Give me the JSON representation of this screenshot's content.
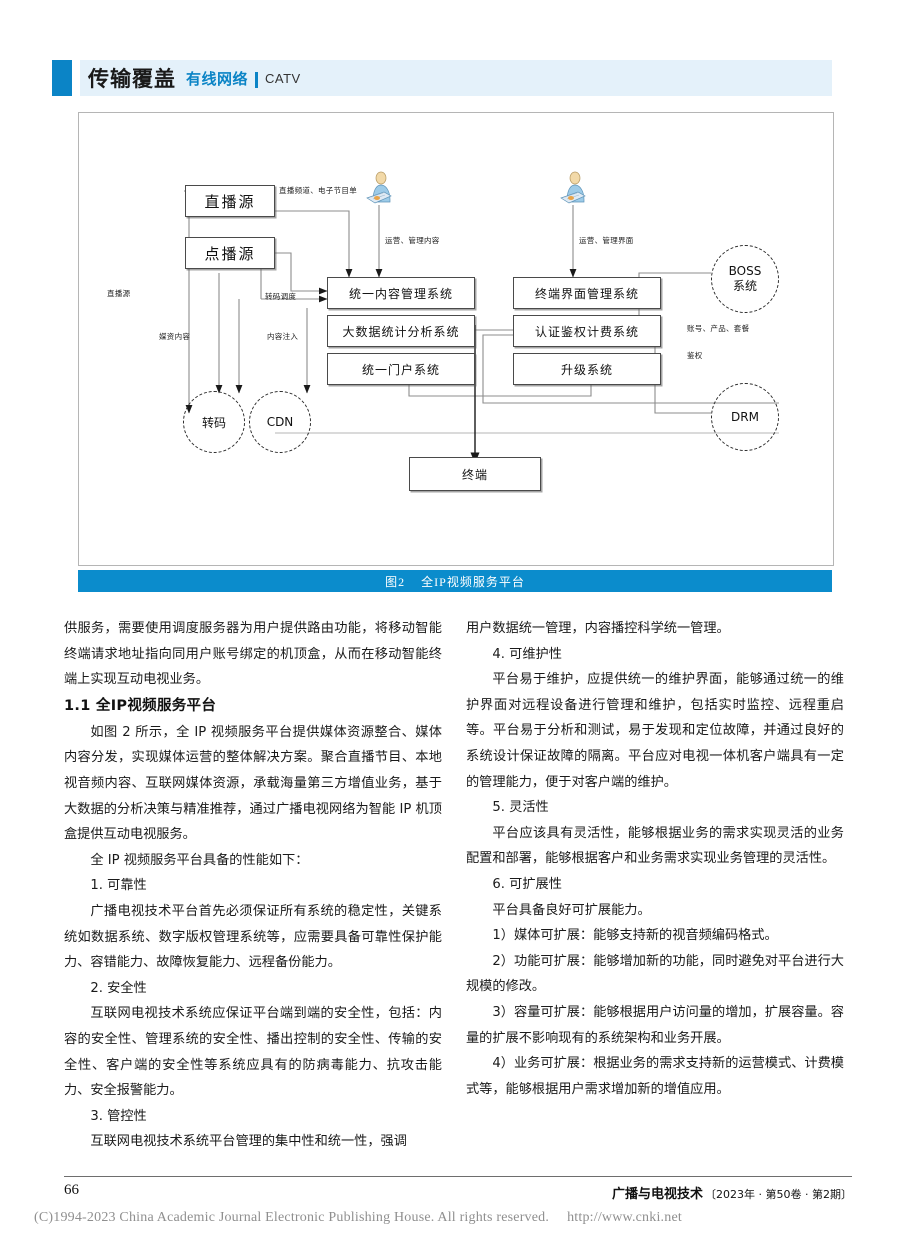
{
  "running_head": {
    "section": "传输覆盖",
    "category": "有线网络",
    "category_en": "CATV",
    "accent_color": "#0b84c6",
    "band_color": "#e4f1fa"
  },
  "figure": {
    "caption_number": "图2",
    "caption_title": "全IP视频服务平台",
    "caption_bar_color": "#0b8ccc",
    "nodes": [
      {
        "id": "live-source",
        "label": "直播源"
      },
      {
        "id": "vod-source",
        "label": "点播源"
      },
      {
        "id": "content-mgmt",
        "label": "统一内容管理系统"
      },
      {
        "id": "bigdata",
        "label": "大数据统计分析系统"
      },
      {
        "id": "portal",
        "label": "统一门户系统"
      },
      {
        "id": "terminal-ui-mgmt",
        "label": "终端界面管理系统"
      },
      {
        "id": "auth-billing",
        "label": "认证鉴权计费系统"
      },
      {
        "id": "upgrade",
        "label": "升级系统"
      },
      {
        "id": "terminal",
        "label": "终端"
      }
    ],
    "circles": [
      {
        "id": "transcode",
        "label": "转码"
      },
      {
        "id": "cdn",
        "label": "CDN"
      },
      {
        "id": "boss",
        "label_line1": "BOSS",
        "label_line2": "系统"
      },
      {
        "id": "drm",
        "label": "DRM"
      }
    ],
    "edge_labels": [
      {
        "id": "epg",
        "text": "直播频道、电子节目单"
      },
      {
        "id": "ops-content",
        "text": "运营、管理内容"
      },
      {
        "id": "ops-ui",
        "text": "运营、管理界面"
      },
      {
        "id": "live-src-side",
        "text": "直播源"
      },
      {
        "id": "media-asset",
        "text": "媒资内容"
      },
      {
        "id": "transcode-sched",
        "text": "转码调度"
      },
      {
        "id": "content-inject",
        "text": "内容注入"
      },
      {
        "id": "account",
        "text": "账号、产品、套餐"
      },
      {
        "id": "authz",
        "text": "鉴权"
      }
    ]
  },
  "body": {
    "left": {
      "para_cont": "供服务，需要使用调度服务器为用户提供路由功能，将移动智能终端请求地址指向同用户账号绑定的机顶盒，从而在移动智能终端上实现互动电视业务。",
      "heading": "1.1  全IP视频服务平台",
      "p1": "如图 2 所示，全 IP 视频服务平台提供媒体资源整合、媒体内容分发，实现媒体运营的整体解决方案。聚合直播节目、本地视音频内容、互联网媒体资源，承载海量第三方增值业务，基于大数据的分析决策与精准推荐，通过广播电视网络为智能 IP 机顶盒提供互动电视服务。",
      "p2": "全 IP 视频服务平台具备的性能如下：",
      "p3": "1. 可靠性",
      "p4": "广播电视技术平台首先必须保证所有系统的稳定性，关键系统如数据系统、数字版权管理系统等，应需要具备可靠性保护能力、容错能力、故障恢复能力、远程备份能力。",
      "p5": "2. 安全性",
      "p6": "互联网电视技术系统应保证平台端到端的安全性，包括：内容的安全性、管理系统的安全性、播出控制的安全性、传输的安全性、客户端的安全性等系统应具有的防病毒能力、抗攻击能力、安全报警能力。",
      "p7": "3. 管控性",
      "p8": "互联网电视技术系统平台管理的集中性和统一性，强调"
    },
    "right": {
      "p1": "用户数据统一管理，内容播控科学统一管理。",
      "p2": "4. 可维护性",
      "p3": "平台易于维护，应提供统一的维护界面，能够通过统一的维护界面对远程设备进行管理和维护，包括实时监控、远程重启等。平台易于分析和测试，易于发现和定位故障，并通过良好的系统设计保证故障的隔离。平台应对电视一体机客户端具有一定的管理能力，便于对客户端的维护。",
      "p4": "5. 灵活性",
      "p5": "平台应该具有灵活性，能够根据业务的需求实现灵活的业务配置和部署，能够根据客户和业务需求实现业务管理的灵活性。",
      "p6": "6. 可扩展性",
      "p7": "平台具备良好可扩展能力。",
      "p8": "1）媒体可扩展：能够支持新的视音频编码格式。",
      "p9": "2）功能可扩展：能够增加新的功能，同时避免对平台进行大规模的修改。",
      "p10": "3）容量可扩展：能够根据用户访问量的增加，扩展容量。容量的扩展不影响现有的系统架构和业务开展。",
      "p11": "4）业务可扩展：根据业务的需求支持新的运营模式、计费模式等，能够根据用户需求增加新的增值应用。"
    }
  },
  "footer": {
    "page_number": "66",
    "journal_name": "广播与电视技术",
    "issue": "〔2023年 · 第50卷 · 第2期〕",
    "copyright": "(C)1994-2023 China Academic Journal Electronic Publishing House. All rights reserved.",
    "url": "http://www.cnki.net"
  }
}
